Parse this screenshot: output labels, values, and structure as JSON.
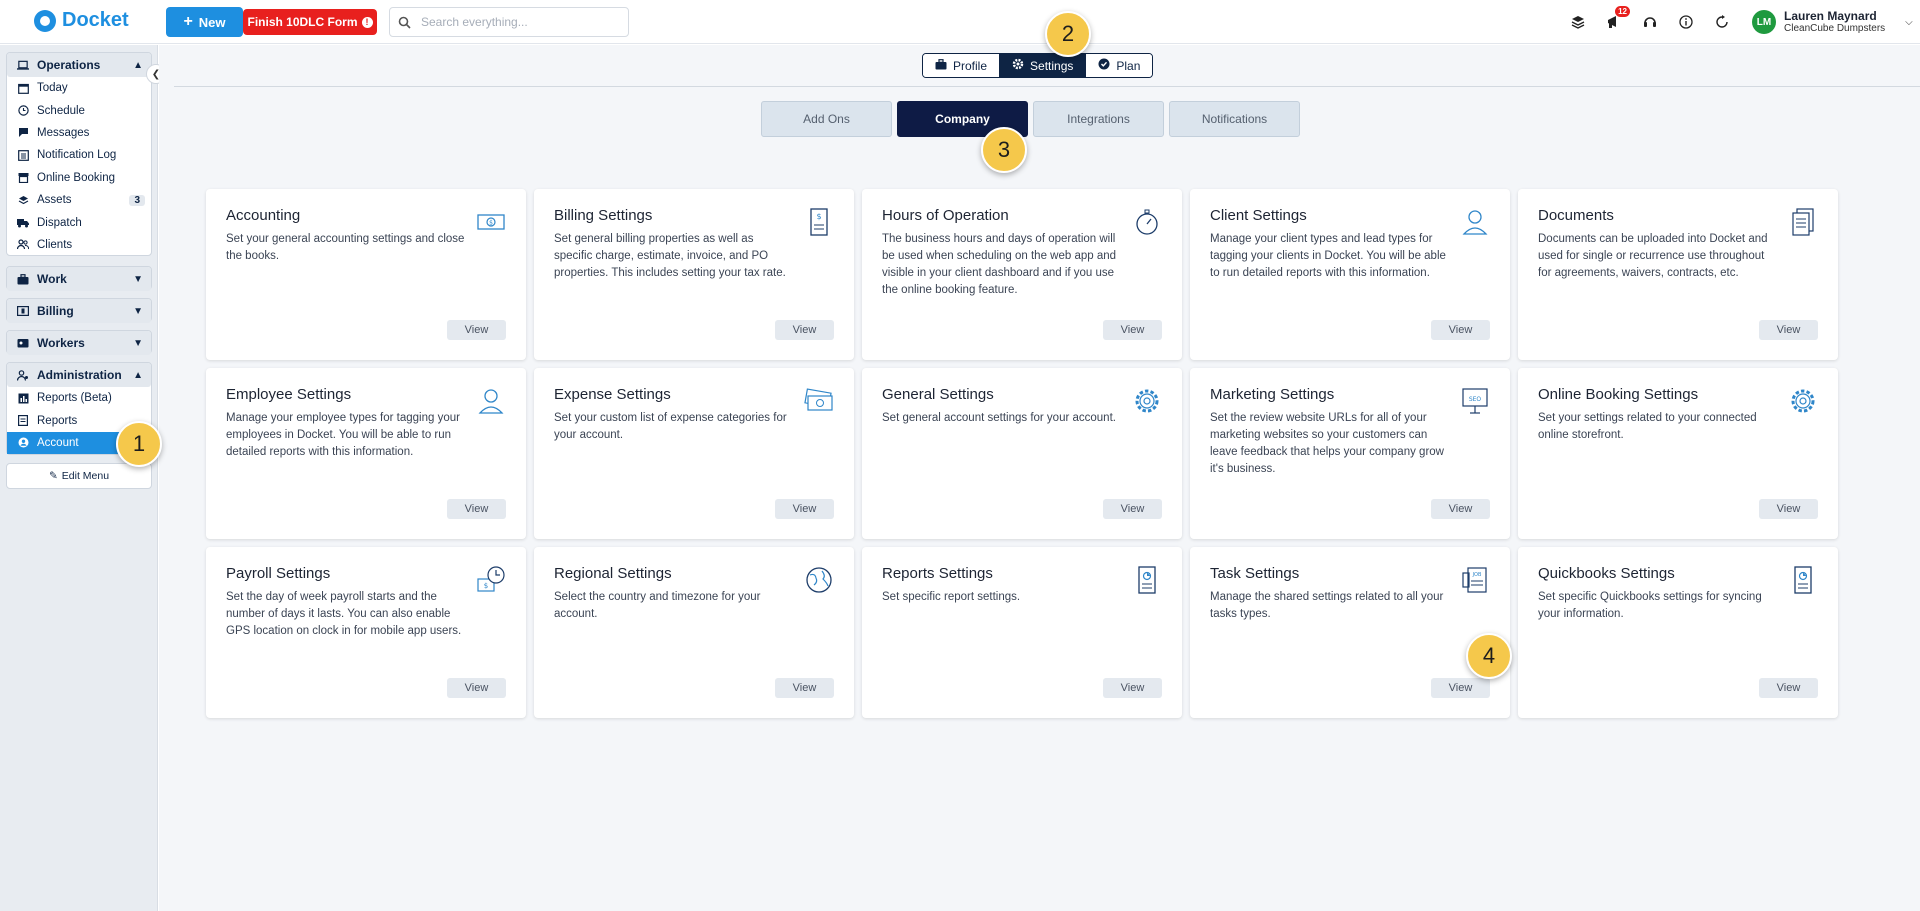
{
  "brand": {
    "name": "Docket"
  },
  "topbar": {
    "new_label": "New",
    "finish_label": "Finish 10DLC Form",
    "search_placeholder": "Search everything...",
    "notification_count": "12",
    "user_initials": "LM",
    "user_name": "Lauren Maynard",
    "user_company": "CleanCube Dumpsters"
  },
  "sidebar": {
    "operations": {
      "label": "Operations",
      "items": [
        {
          "label": "Today",
          "icon": "calendar-icon"
        },
        {
          "label": "Schedule",
          "icon": "clock-icon"
        },
        {
          "label": "Messages",
          "icon": "chat-icon"
        },
        {
          "label": "Notification Log",
          "icon": "list-icon"
        },
        {
          "label": "Online Booking",
          "icon": "store-icon"
        },
        {
          "label": "Assets",
          "icon": "layers-icon",
          "count": "3"
        },
        {
          "label": "Dispatch",
          "icon": "truck-icon"
        },
        {
          "label": "Clients",
          "icon": "users-icon"
        }
      ]
    },
    "work": {
      "label": "Work"
    },
    "billing": {
      "label": "Billing"
    },
    "workers": {
      "label": "Workers"
    },
    "administration": {
      "label": "Administration",
      "items": [
        {
          "label": "Reports (Beta)",
          "icon": "bar-chart-icon"
        },
        {
          "label": "Reports",
          "icon": "document-icon"
        },
        {
          "label": "Account",
          "icon": "user-circle-icon",
          "active": true
        }
      ]
    },
    "edit_menu": "Edit Menu"
  },
  "settings_tabs": [
    {
      "label": "Profile",
      "icon": "briefcase-icon"
    },
    {
      "label": "Settings",
      "icon": "gear-icon",
      "active": true
    },
    {
      "label": "Plan",
      "icon": "badge-check-icon"
    }
  ],
  "sub_tabs": [
    {
      "label": "Add Ons"
    },
    {
      "label": "Company",
      "active": true
    },
    {
      "label": "Integrations"
    },
    {
      "label": "Notifications"
    }
  ],
  "cards": [
    {
      "title": "Accounting",
      "desc": "Set your general accounting settings and close the books.",
      "icon": "money-icon",
      "view": "View"
    },
    {
      "title": "Billing Settings",
      "desc": "Set general billing properties as well as specific charge, estimate, invoice, and PO properties. This includes setting your tax rate.",
      "icon": "invoice-icon",
      "view": "View"
    },
    {
      "title": "Hours of Operation",
      "desc": "The business hours and days of operation will be used when scheduling on the web app and visible in your client dashboard and if you use the online booking feature.",
      "icon": "stopwatch-icon",
      "view": "View"
    },
    {
      "title": "Client Settings",
      "desc": "Manage your client types and lead types for tagging your clients in Docket. You will be able to run detailed reports with this information.",
      "icon": "person-icon",
      "view": "View"
    },
    {
      "title": "Documents",
      "desc": "Documents can be uploaded into Docket and used for single or recurrence use throughout for agreements, waivers, contracts, etc.",
      "icon": "documents-icon",
      "view": "View"
    },
    {
      "title": "Employee Settings",
      "desc": "Manage your employee types for tagging your employees in Docket. You will be able to run detailed reports with this information.",
      "icon": "person-icon",
      "view": "View"
    },
    {
      "title": "Expense Settings",
      "desc": "Set your custom list of expense categories for your account.",
      "icon": "cash-icon",
      "view": "View"
    },
    {
      "title": "General Settings",
      "desc": "Set general account settings for your account.",
      "icon": "gear-icon",
      "view": "View"
    },
    {
      "title": "Marketing Settings",
      "desc": "Set the review website URLs for all of your marketing websites so your customers can leave feedback that helps your company grow it's business.",
      "icon": "seo-board-icon",
      "view": "View"
    },
    {
      "title": "Online Booking Settings",
      "desc": "Set your settings related to your connected online storefront.",
      "icon": "gear-icon",
      "view": "View"
    },
    {
      "title": "Payroll Settings",
      "desc": "Set the day of week payroll starts and the number of days it lasts. You can also enable GPS location on clock in for mobile app users.",
      "icon": "payroll-clock-icon",
      "view": "View"
    },
    {
      "title": "Regional Settings",
      "desc": "Select the country and timezone for your account.",
      "icon": "globe-icon",
      "view": "View"
    },
    {
      "title": "Reports Settings",
      "desc": "Set specific report settings.",
      "icon": "report-icon",
      "view": "View"
    },
    {
      "title": "Task Settings",
      "desc": "Manage the shared settings related to all your tasks types.",
      "icon": "job-icon",
      "view": "View"
    },
    {
      "title": "Quickbooks Settings",
      "desc": "Set specific Quickbooks settings for syncing your information.",
      "icon": "report-icon",
      "view": "View"
    }
  ],
  "markers": [
    "1",
    "2",
    "3",
    "4"
  ],
  "colors": {
    "accent": "#1e8fe0",
    "navy": "#0e1b45",
    "alert": "#e8201e",
    "marker": "#f5c84b"
  }
}
